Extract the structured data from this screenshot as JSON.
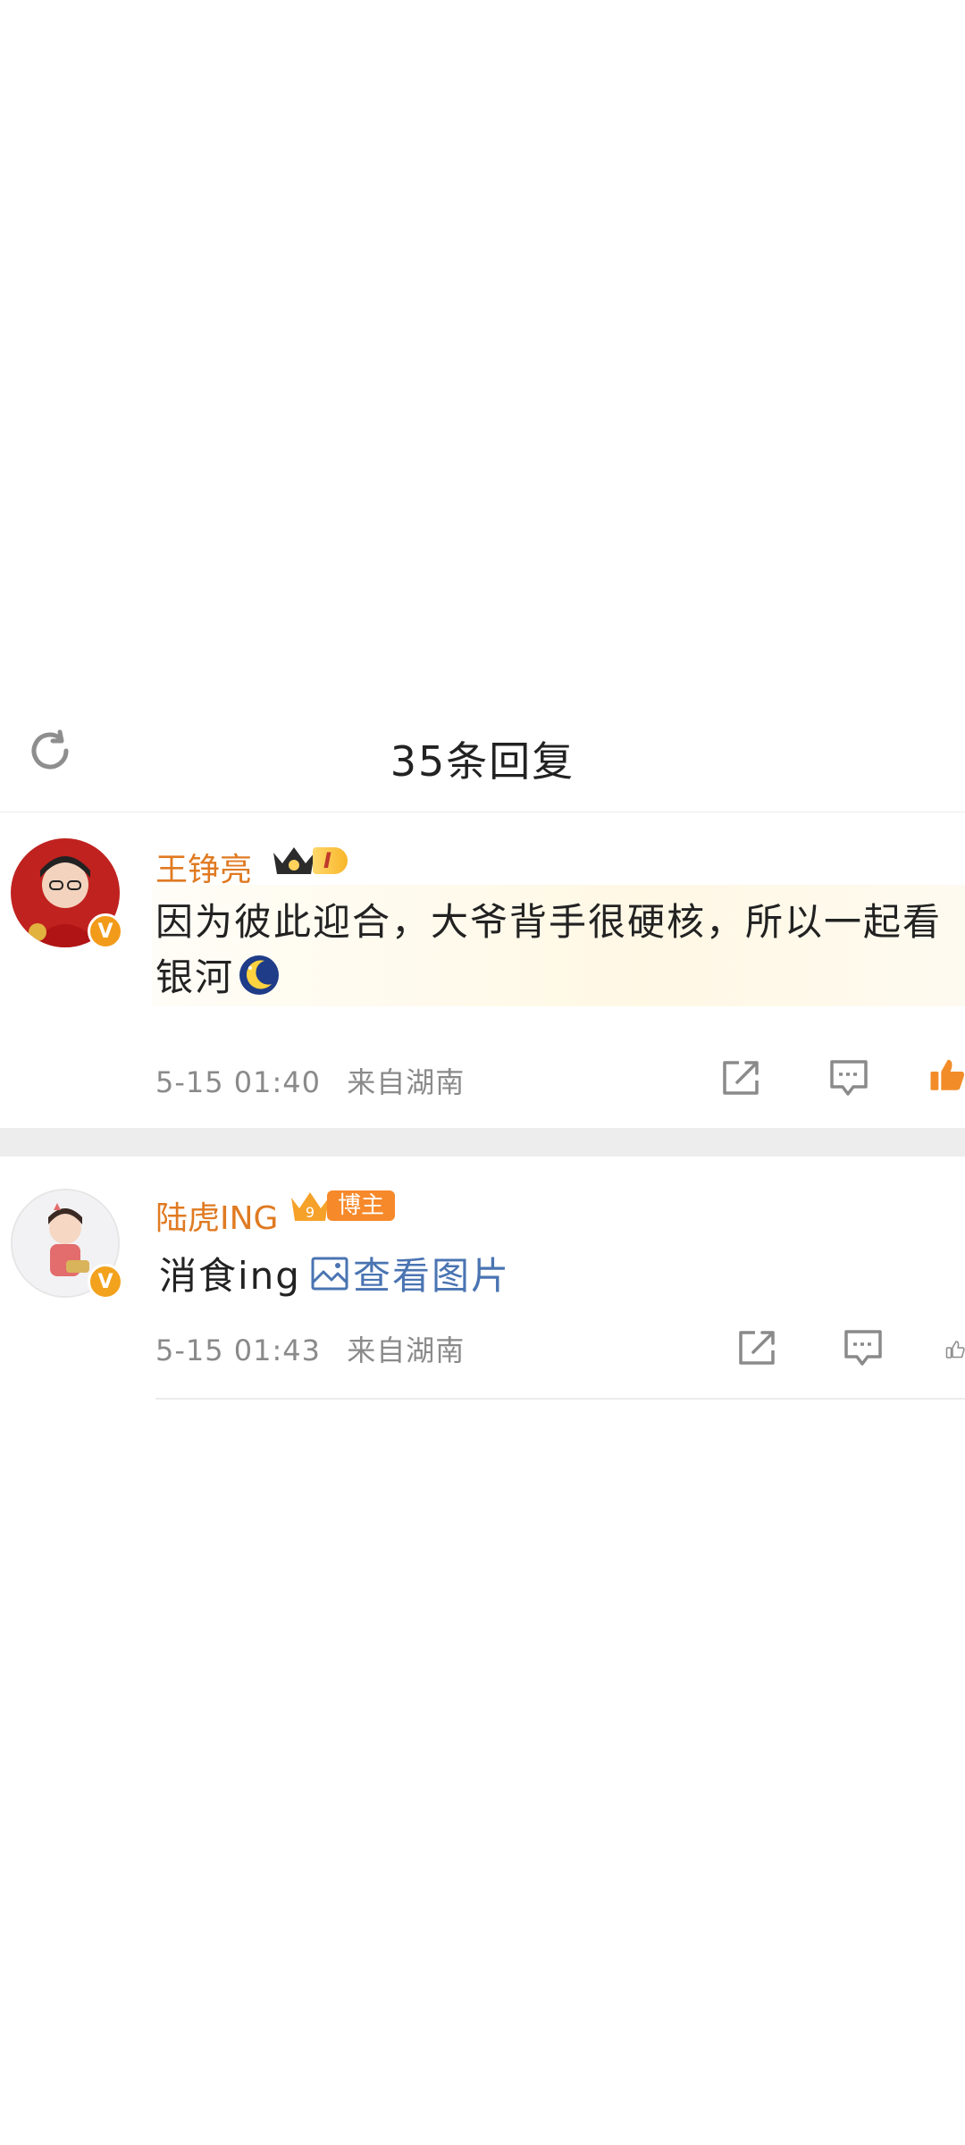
{
  "header": {
    "title": "35条回复"
  },
  "comments": [
    {
      "username": "王铮亮",
      "level_label": "I",
      "text_line1": "因为彼此迎合，大爷背手很硬核，所以一起看",
      "text_line2": "银河",
      "time": "5-15 01:40",
      "source": "来自湖南"
    },
    {
      "username": "陆虎ING",
      "crown_level": "9",
      "badge_label": "博主",
      "text": "消食ing",
      "link_label": "查看图片",
      "time": "5-15 01:43",
      "source": "来自湖南"
    }
  ],
  "colors": {
    "username": "#e07a22",
    "link": "#4a74b2",
    "like_active": "#f28c28",
    "separator": "#ededed"
  },
  "icons": [
    "refresh-icon",
    "share-icon",
    "comment-icon",
    "like-icon",
    "picture-icon",
    "verified-icon",
    "crown-icon",
    "moon-emoji"
  ]
}
